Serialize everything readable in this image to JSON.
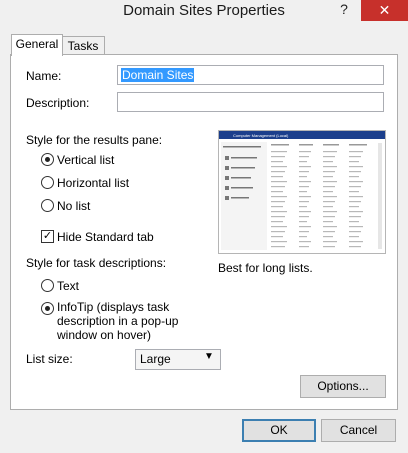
{
  "window": {
    "title": "Domain Sites Properties",
    "help": "?",
    "close": "✕"
  },
  "tabs": [
    {
      "label": "General"
    },
    {
      "label": "Tasks"
    }
  ],
  "fields": {
    "name_label": "Name:",
    "name_value": "Domain Sites",
    "description_label": "Description:",
    "description_value": ""
  },
  "results_pane": {
    "heading": "Style for the results pane:",
    "options": [
      {
        "label": "Vertical list",
        "selected": true
      },
      {
        "label": "Horizontal list",
        "selected": false
      },
      {
        "label": "No list",
        "selected": false
      }
    ],
    "hide_standard_tab": {
      "label": "Hide Standard tab",
      "checked": true
    }
  },
  "preview": {
    "header": "Computer Management (Local)",
    "caption": "Best for long lists."
  },
  "task_descriptions": {
    "heading": "Style for task descriptions:",
    "options": [
      {
        "label": "Text",
        "selected": false
      },
      {
        "label": "InfoTip (displays task description in a pop-up window on hover)",
        "selected": true
      }
    ]
  },
  "list_size": {
    "label": "List size:",
    "value": "Large"
  },
  "buttons": {
    "options": "Options...",
    "ok": "OK",
    "cancel": "Cancel"
  }
}
